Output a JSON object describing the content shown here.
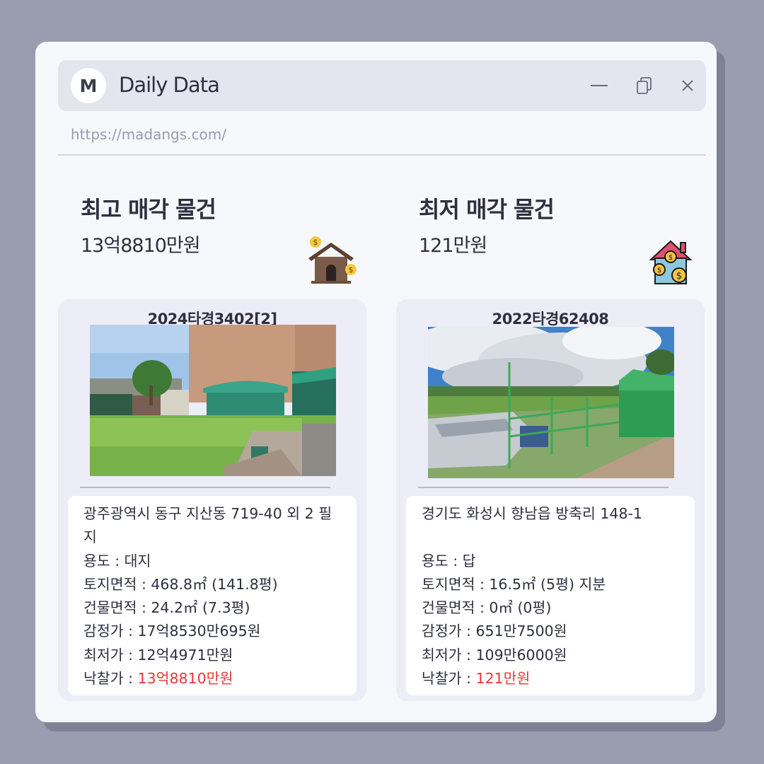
{
  "window": {
    "avatar_letter": "M",
    "title": "Daily Data",
    "url": "https://madangs.com/",
    "controls": [
      "minimize-icon",
      "copy-icon",
      "close-icon"
    ]
  },
  "highest": {
    "heading": "최고 매각 물건",
    "price": "13억8810만원",
    "icon": "house-money-icon",
    "case_no": "2024타경3402[2]",
    "address": "광주광역시 동구 지산동 719-40 외 2 필지",
    "usage": "용도 : 대지",
    "land_area": "토지면적 : 468.8㎡ (141.8평)",
    "building_area": "건물면적 : 24.2㎡ (7.3평)",
    "appraisal": "감정가 : 17억8530만695원",
    "minimum": "최저가 : 12억4971만원",
    "winning_label": "낙찰가 : ",
    "winning_value": "13억8810만원"
  },
  "lowest": {
    "heading": "최저 매각 물건",
    "price": "121만원",
    "icon": "house-coins-icon",
    "case_no": "2022타경62408",
    "address": "경기도 화성시 향남읍 방축리 148-1",
    "usage": "용도 : 답",
    "land_area": "토지면적 : 16.5㎡ (5평) 지분",
    "building_area": "건물면적 : 0㎡ (0평)",
    "appraisal": "감정가 : 651만7500원",
    "minimum": "최저가 : 109만6000원",
    "winning_label": "낙찰가 : ",
    "winning_value": "121만원"
  },
  "colors": {
    "background": "#9a9cb0",
    "window": "#f7f8fc",
    "titlebar": "#e4e6ef",
    "card": "#ecedf7",
    "highlight": "#e5393b"
  }
}
